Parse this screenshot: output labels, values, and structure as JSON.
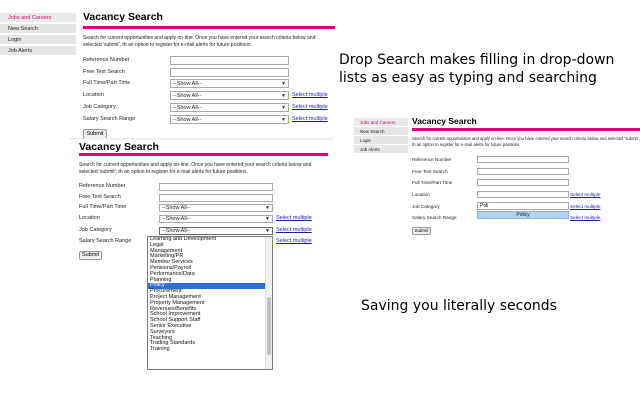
{
  "nav": {
    "items": [
      {
        "label": "Jobs and Careers",
        "active": true
      },
      {
        "label": "New Search",
        "active": false
      },
      {
        "label": "Login",
        "active": false
      },
      {
        "label": "Job Alerts",
        "active": false
      }
    ]
  },
  "form": {
    "title": "Vacancy Search",
    "intro": "Search for current opportunities and apply on-line. Once you have entered your search criteria below and selected 'submit', th an option to register for e-mail alerts for future positions.",
    "fields": {
      "reference_number": "Reference Number",
      "free_text_search": "Free Text Search",
      "full_time_part_time": "Full Time/Part Time",
      "location": "Location",
      "job_category": "Job Category",
      "salary_search_range": "Salary Search Range"
    },
    "select_default": "--Show All--",
    "select_multiple": "Select multiple",
    "submit": "Submit"
  },
  "captions": {
    "headline": "Drop Search makes filling in drop-down lists as easy as typing and searching",
    "tagline": "Saving you literally seconds"
  },
  "dropdown": {
    "options": [
      "Learning and Development",
      "Legal",
      "Management",
      "Marketing/PR",
      "Member Services",
      "Pensions/Payroll",
      "Performance/Data",
      "Planning",
      "Policy",
      "Procurement",
      "Project Management",
      "Property Management",
      "Revenues/Benefits",
      "School Improvement",
      "School Support Staff",
      "Senior Executive",
      "Surveyors",
      "Teaching",
      "Trading Standards",
      "Training"
    ],
    "selected": "Policy"
  },
  "search_demo": {
    "typed": "Poli",
    "suggestion": "Policy"
  },
  "colors": {
    "accent": "#e0007a",
    "nav_active_text": "#d4006c",
    "highlight": "#2f6fd4"
  }
}
